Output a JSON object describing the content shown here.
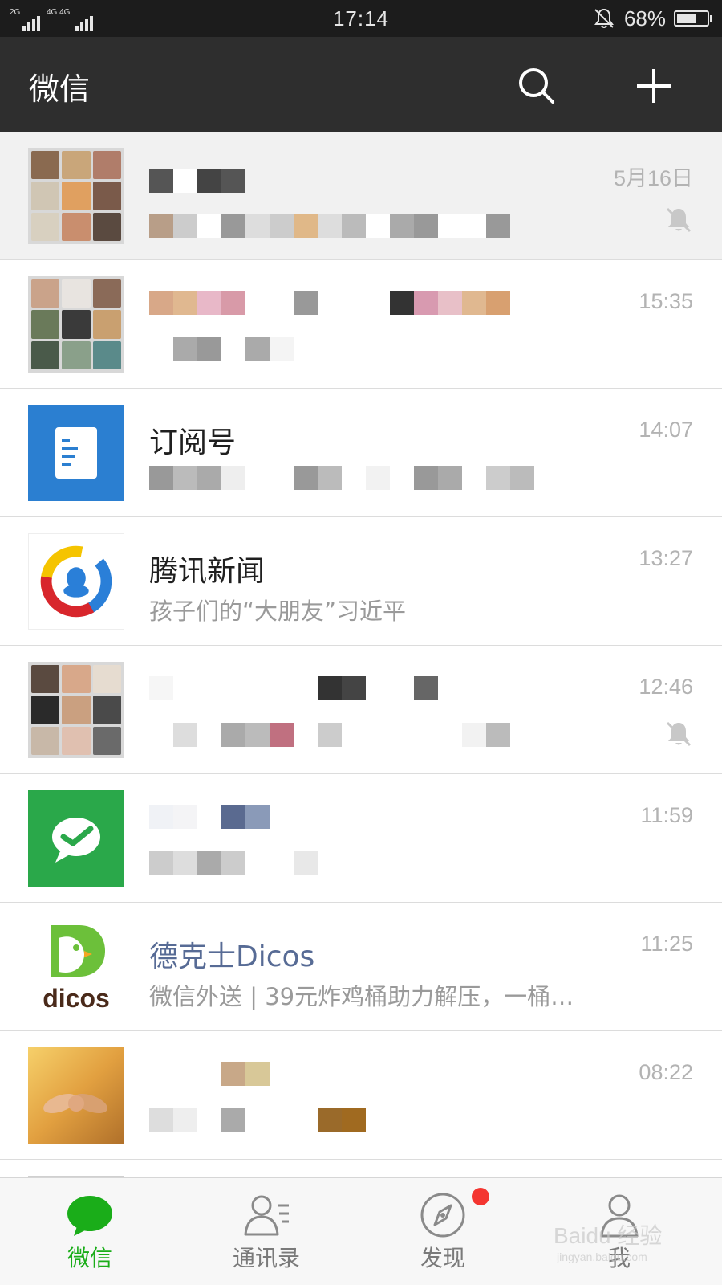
{
  "status_bar": {
    "net1": "2G",
    "net2": "4G 4G",
    "time": "17:14",
    "battery": "68%",
    "battery_level": 0.68
  },
  "header": {
    "title": "微信",
    "search_icon": "search-icon",
    "add_icon": "plus-icon"
  },
  "chats": [
    {
      "name": "",
      "preview": "",
      "time": "5月16日",
      "muted": true,
      "pinned": true
    },
    {
      "name": "",
      "preview": "",
      "time": "15:35",
      "muted": false
    },
    {
      "name": "订阅号",
      "preview": "",
      "time": "14:07",
      "muted": false
    },
    {
      "name": "腾讯新闻",
      "preview": "孩子们的“大朋友”习近平",
      "time": "13:27",
      "muted": false
    },
    {
      "name": "",
      "preview": "",
      "time": "12:46",
      "muted": true
    },
    {
      "name": "",
      "preview": "",
      "time": "11:59",
      "muted": false
    },
    {
      "name": "德克士Dicos",
      "preview": "微信外送 | 39元炸鸡桶助力解压，一桶…",
      "time": "11:25",
      "muted": false,
      "brand": "dicos"
    },
    {
      "name": "",
      "preview": "",
      "time": "08:22",
      "muted": false
    }
  ],
  "tabs": [
    {
      "label": "微信",
      "icon": "chat-bubble-icon",
      "active": true
    },
    {
      "label": "通讯录",
      "icon": "contacts-icon",
      "active": false
    },
    {
      "label": "发现",
      "icon": "compass-icon",
      "active": false,
      "badge": true
    },
    {
      "label": "我",
      "icon": "person-icon",
      "active": false
    }
  ],
  "colors": {
    "accent": "#1aad19",
    "header_bg": "#2e2e2e",
    "link": "#576b95",
    "badge": "#f43530"
  },
  "watermark": {
    "text": "Baidu 经验",
    "url": "jingyan.baidu.com"
  }
}
